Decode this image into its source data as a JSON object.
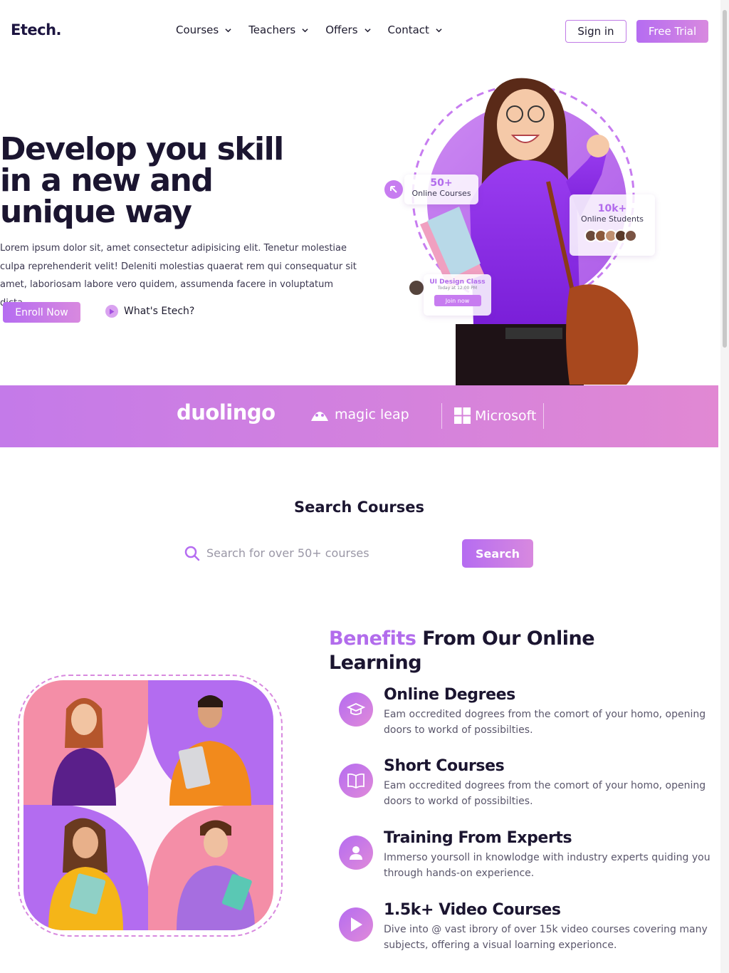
{
  "header": {
    "logo": "Etech.",
    "nav": [
      "Courses",
      "Teachers",
      "Offers",
      "Contact"
    ],
    "sign_in": "Sign in",
    "free_trial": "Free Trial"
  },
  "hero": {
    "title_line1": "Develop you skill",
    "title_line2": "in a new and",
    "title_line3": "unique way",
    "description": "Lorem ipsum dolor sit, amet consectetur adipisicing elit. Tenetur molestiae culpa reprehenderit velit! Deleniti molestias quaerat rem qui consequatur sit amet, laboriosam labore vero quidem, assumenda facere in voluptatum dicta.",
    "enroll": "Enroll Now",
    "whats": "What's Etech?",
    "card_courses_count": "50+",
    "card_courses_label": "Online Courses",
    "card_students_count": "10k+",
    "card_students_label": "Online Students",
    "card_class_title": "UI Design Class",
    "card_class_time": "Today at 12:00 PM",
    "card_class_join": "Join now"
  },
  "brands": [
    "duolingo",
    "magic leap",
    "Microsoft"
  ],
  "search": {
    "title": "Search Courses",
    "placeholder": "Search for over 50+ courses",
    "button": "Search"
  },
  "benefits": {
    "title_accent": "Benefits",
    "title_rest": " From Our Online Learning",
    "items": [
      {
        "icon": "graduation-cap-icon",
        "title": "Online Degrees",
        "desc": "Eam occredited dogrees from the comort of your homo, opening doors to workd of possibilties."
      },
      {
        "icon": "book-icon",
        "title": "Short Courses",
        "desc": "Eam occredited dogrees from the comort of your homo, opening doors to workd of possibilties."
      },
      {
        "icon": "user-icon",
        "title": "Training From Experts",
        "desc": "Immerso yoursoll in knowlodge with industry experts quiding you through hands-on experience."
      },
      {
        "icon": "play-icon",
        "title": "1.5k+ Video Courses",
        "desc": "Dive into @ vast ibrory of over 15k video courses covering many subjects, offering a visual loarning experionce."
      }
    ]
  },
  "colors": {
    "accent": "#b56cf1",
    "accent2": "#d889df",
    "pink": "#f28aa6",
    "dark": "#1b1530"
  }
}
